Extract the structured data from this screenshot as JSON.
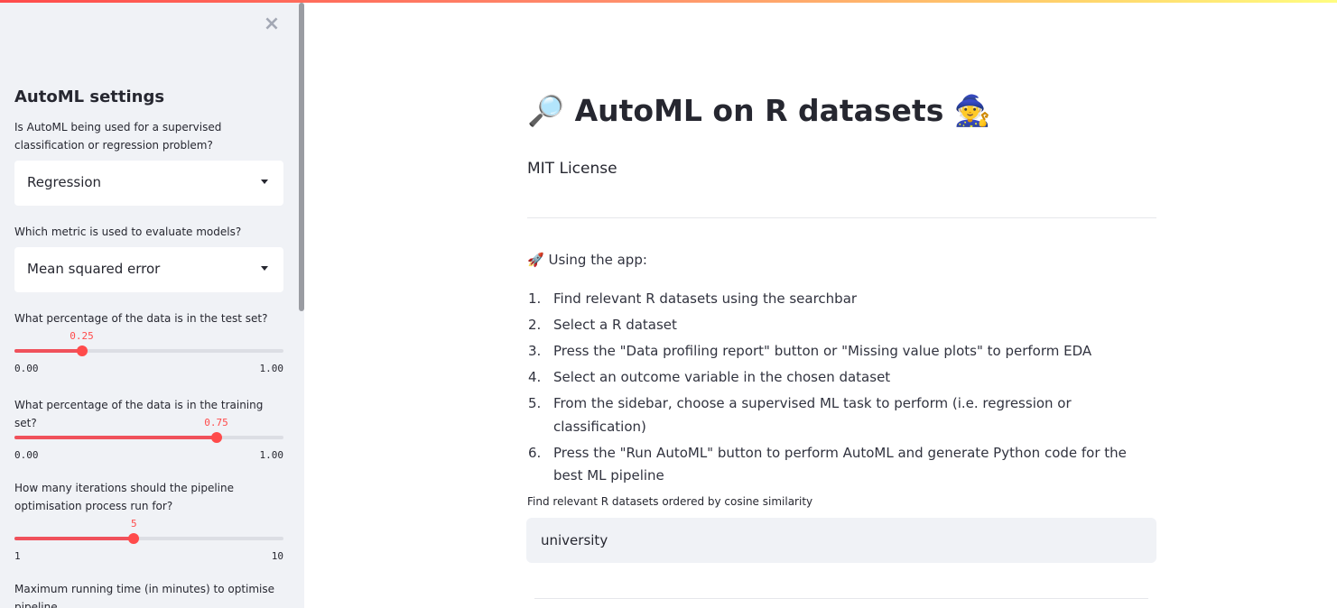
{
  "sidebar": {
    "title": "AutoML settings",
    "problem_label": "Is AutoML being used for a supervised classification or regression problem?",
    "problem_value": "Regression",
    "metric_label": "Which metric is used to evaluate models?",
    "metric_value": "Mean squared error",
    "test_label": "What percentage of the data is in the test set?",
    "test_slider": {
      "value": "0.25",
      "min": "0.00",
      "max": "1.00",
      "fraction": 0.25
    },
    "train_label": "What percentage of the data is in the training set?",
    "train_slider": {
      "value": "0.75",
      "min": "0.00",
      "max": "1.00",
      "fraction": 0.75
    },
    "iter_label": "How many iterations should the pipeline optimisation process run for?",
    "iter_slider": {
      "value": "5",
      "min": "1",
      "max": "10",
      "fraction": 0.444
    },
    "time_label": "Maximum running time (in minutes) to optimise pipeline"
  },
  "main": {
    "title_icon": "🔎",
    "title_text": "AutoML on R datasets",
    "title_icon_end": "🧙",
    "subtitle": "MIT License",
    "using_icon": "🚀",
    "using_text": "Using the app:",
    "steps": [
      {
        "num": "1.",
        "text": "Find relevant R datasets using the searchbar"
      },
      {
        "num": "2.",
        "text": "Select a R dataset"
      },
      {
        "num": "3.",
        "text": "Press the \"Data profiling report\" button or \"Missing value plots\" to perform EDA"
      },
      {
        "num": "4.",
        "text": "Select an outcome variable in the chosen dataset"
      },
      {
        "num": "5.",
        "text": "From the sidebar, choose a supervised ML task to perform (i.e. regression or classification)"
      },
      {
        "num": "6.",
        "text": "Press the \"Run AutoML\" button to perform AutoML and generate Python code for the best ML pipeline"
      }
    ],
    "search_label": "Find relevant R datasets ordered by cosine similarity",
    "search_value": "university"
  },
  "colors": {
    "accent": "#ff4b4b",
    "sidebar_bg": "#f0f2f6",
    "text": "#262730"
  },
  "icons": {
    "close": "close-icon",
    "caret": "chevron-down-icon"
  }
}
